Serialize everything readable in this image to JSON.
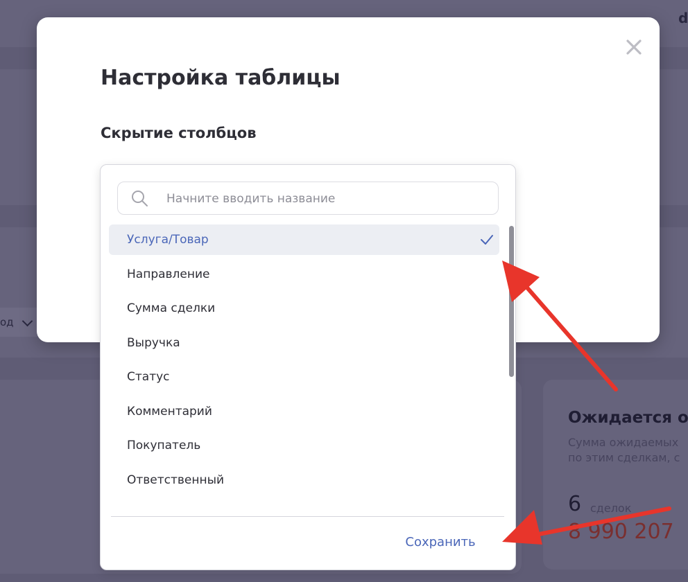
{
  "background": {
    "corner_text": "d",
    "filter_label": "од",
    "card": {
      "title": "Ожидается о",
      "description_line1": "Сумма ожидаемых",
      "description_line2": "по этим сделкам, с",
      "count": "6",
      "count_label": "сделок",
      "amount": "8 990 207"
    }
  },
  "modal": {
    "title": "Настройка таблицы",
    "subtitle": "Скрытие столбцов",
    "close_icon": "close-icon"
  },
  "dropdown": {
    "search": {
      "placeholder": "Начните вводить название",
      "value": "",
      "icon": "search-icon"
    },
    "items": [
      {
        "label": "Услуга/Товар",
        "selected": true
      },
      {
        "label": "Направление",
        "selected": false
      },
      {
        "label": "Сумма сделки",
        "selected": false
      },
      {
        "label": "Выручка",
        "selected": false
      },
      {
        "label": "Статус",
        "selected": false
      },
      {
        "label": "Комментарий",
        "selected": false
      },
      {
        "label": "Покупатель",
        "selected": false
      },
      {
        "label": "Ответственный",
        "selected": false
      }
    ],
    "save_label": "Сохранить"
  },
  "colors": {
    "accent": "#4a66b8",
    "overlay": "#5f5c75",
    "annotation_arrow": "#e8352b",
    "amount": "#7a2f2f"
  }
}
